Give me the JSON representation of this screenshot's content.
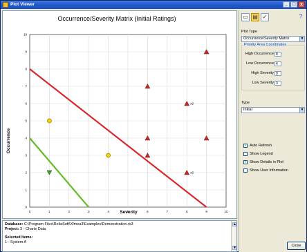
{
  "window": {
    "title": "Plot Viewer",
    "minimize": "_",
    "maximize": "□",
    "close": "x"
  },
  "chart_data": {
    "type": "scatter",
    "title": "Occurrence/Severity Matrix (Initial Ratings)",
    "xlabel": "Severity",
    "ylabel": "Occurrence",
    "xlim": [
      0,
      10
    ],
    "ylim": [
      0,
      10
    ],
    "xticks": [
      "0",
      "1",
      "2",
      "3",
      "4",
      "5",
      "6",
      "7",
      "8",
      "9",
      "10"
    ],
    "yticks": [
      "0",
      "1",
      "2",
      "3",
      "4",
      "5",
      "6",
      "7",
      "8",
      "9",
      "10"
    ],
    "grid": true,
    "lines": [
      {
        "name": "",
        "color": "#d9262b",
        "x": [
          0,
          9
        ],
        "y": [
          8,
          0
        ]
      },
      {
        "name": "",
        "color": "#66bb22",
        "x": [
          0,
          3
        ],
        "y": [
          4,
          0
        ]
      }
    ],
    "series": [
      {
        "marker": "triangle",
        "color": "#bf2a2a",
        "points": [
          {
            "x": 9,
            "y": 9,
            "label": ""
          },
          {
            "x": 6,
            "y": 7,
            "label": ""
          },
          {
            "x": 8,
            "y": 6,
            "label": "x2"
          },
          {
            "x": 6,
            "y": 4,
            "label": ""
          },
          {
            "x": 9,
            "y": 4,
            "label": ""
          },
          {
            "x": 6,
            "y": 3,
            "label": ""
          },
          {
            "x": 8,
            "y": 2,
            "label": "x2"
          }
        ]
      },
      {
        "marker": "circle",
        "color": "#f2d100",
        "points": [
          {
            "x": 1,
            "y": 5,
            "label": ""
          },
          {
            "x": 4,
            "y": 3,
            "label": ""
          }
        ]
      },
      {
        "marker": "triangle-down",
        "color": "#3a9a2a",
        "points": [
          {
            "x": 1,
            "y": 2,
            "label": ""
          }
        ]
      }
    ]
  },
  "info": {
    "database_label": "Database:",
    "database_value": "C:\\Program Files\\ReliaSoft\\Xfmea3\\Examples\\Demonstration.rx3",
    "project_label": "Project:",
    "project_value": "3 - Charts Data",
    "selected_label": "Selected Items:",
    "selected_value": "1 - System A"
  },
  "toolbar": {
    "icons": [
      "window-icon",
      "chart-icon",
      "check-icon"
    ],
    "help": "?"
  },
  "plot_type": {
    "label": "Plot Type",
    "value": "Occurrence/Severity Matrix",
    "arrow": "▼"
  },
  "priority": {
    "title": "Priority Area Coordinates",
    "rows": [
      {
        "label": "High Occurrence",
        "value": "8"
      },
      {
        "label": "Low Occurrence",
        "value": "4"
      },
      {
        "label": "High Severity",
        "value": "9"
      },
      {
        "label": "Low Severity",
        "value": "3"
      }
    ]
  },
  "type": {
    "label": "Type",
    "value": "Initial",
    "arrow": "▼"
  },
  "options": [
    {
      "label": "Auto Refresh",
      "checked": true,
      "mark": "✓"
    },
    {
      "label": "Show Legend",
      "checked": false,
      "mark": ""
    },
    {
      "label": "Show Details in Plot",
      "checked": true,
      "mark": "✓"
    },
    {
      "label": "Show User Information",
      "checked": false,
      "mark": ""
    }
  ],
  "close_button": "Close"
}
